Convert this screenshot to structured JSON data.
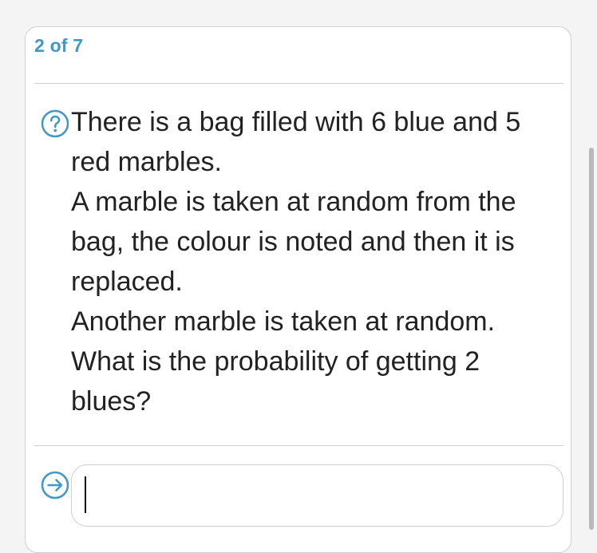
{
  "progress": {
    "text": "2 of 7"
  },
  "question": {
    "icon": "help-circle-icon",
    "lines": [
      "There is a bag filled with 6 blue and 5",
      "red marbles.",
      "A marble is taken at random from the",
      "bag, the colour is noted and then it is",
      "replaced.",
      "Another marble is taken at random.",
      "What is the probability of getting 2",
      "blues?"
    ]
  },
  "answer": {
    "icon": "arrow-right-circle-icon",
    "value": "",
    "placeholder": ""
  },
  "colors": {
    "accent": "#3f98c6",
    "border": "#cfcfcf",
    "text": "#222222",
    "background": "#f4f4f4"
  }
}
